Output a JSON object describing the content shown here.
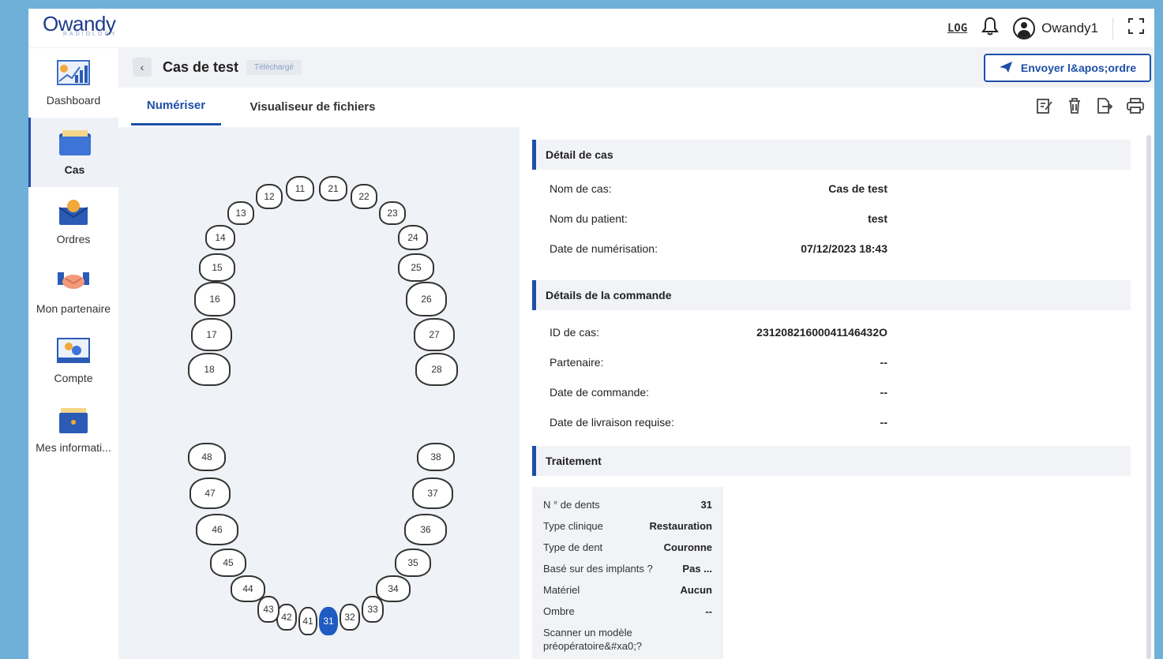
{
  "topbar": {
    "logo_text": "Owandy",
    "logo_sub": "RADIOLOGY",
    "log_label": "LOG",
    "user_name": "Owandy1"
  },
  "sidebar": {
    "items": [
      {
        "label": "Dashboard"
      },
      {
        "label": "Cas"
      },
      {
        "label": "Ordres"
      },
      {
        "label": "Mon partenaire"
      },
      {
        "label": "Compte"
      },
      {
        "label": "Mes informati..."
      }
    ],
    "active_index": 1
  },
  "header": {
    "title": "Cas de test",
    "status": "Téléchargé",
    "send_label": "Envoyer l&apos;ordre"
  },
  "tabs": [
    {
      "label": "Numériser"
    },
    {
      "label": "Visualiseur de fichiers"
    }
  ],
  "teeth": {
    "upper": [
      "11",
      "12",
      "13",
      "14",
      "15",
      "16",
      "17",
      "18",
      "21",
      "22",
      "23",
      "24",
      "25",
      "26",
      "27",
      "28"
    ],
    "lower": [
      "31",
      "32",
      "33",
      "34",
      "35",
      "36",
      "37",
      "38",
      "41",
      "42",
      "43",
      "44",
      "45",
      "46",
      "47",
      "48"
    ],
    "selected": "31"
  },
  "case_detail": {
    "heading": "Détail de cas",
    "rows": [
      {
        "k": "Nom de cas:",
        "v": "Cas de test"
      },
      {
        "k": "Nom du patient:",
        "v": "test"
      },
      {
        "k": "Date de numérisation:",
        "v": "07/12/2023 18:43"
      }
    ]
  },
  "order_detail": {
    "heading": "Détails de la commande",
    "rows": [
      {
        "k": "ID de cas:",
        "v": "23120821600041146432O"
      },
      {
        "k": "Partenaire:",
        "v": "--"
      },
      {
        "k": "Date de commande:",
        "v": "--"
      },
      {
        "k": "Date de livraison requise:",
        "v": "--"
      }
    ]
  },
  "treatment": {
    "heading": "Traitement",
    "rows": [
      {
        "k": "N ° de dents",
        "v": "31"
      },
      {
        "k": "Type clinique",
        "v": "Restauration"
      },
      {
        "k": "Type de dent",
        "v": "Couronne"
      },
      {
        "k": "Basé sur des implants ?",
        "v": "Pas ..."
      },
      {
        "k": "Matériel",
        "v": "Aucun"
      },
      {
        "k": "Ombre",
        "v": "--"
      },
      {
        "k": "Scanner un modèle préopératoire&#xa0;?",
        "v": ""
      }
    ]
  },
  "colors": {
    "accent": "#1e4fa8",
    "selected_tooth": "#1e5bc2",
    "background": "#6fb0d8"
  }
}
